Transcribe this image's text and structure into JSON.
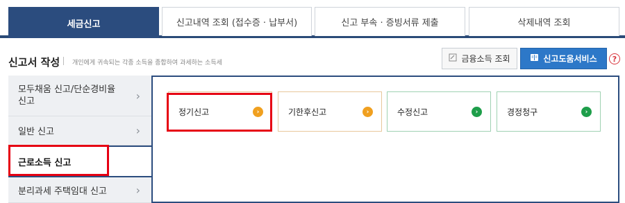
{
  "tabs": [
    {
      "label": "세금신고",
      "active": true
    },
    {
      "label": "신고내역 조회 (접수증 · 납부서)",
      "active": false
    },
    {
      "label": "신고 부속 · 증빙서류 제출",
      "active": false
    },
    {
      "label": "삭제내역 조회",
      "active": false
    }
  ],
  "header": {
    "title": "신고서 작성",
    "subtitle": "개인에게 귀속되는 각종 소득을 종합하여 과세하는 소득세",
    "fin_button": "금융소득 조회",
    "help_button": "신고도움서비스",
    "question_mark": "?"
  },
  "sidebar": {
    "items": [
      {
        "label": "모두채움 신고/단순경비율 신고",
        "active": false
      },
      {
        "label": "일반 신고",
        "active": false
      },
      {
        "label": "근로소득 신고",
        "active": true
      },
      {
        "label": "분리과세 주택임대 신고",
        "active": false
      }
    ],
    "chevron": "›"
  },
  "cards": [
    {
      "label": "정기신고",
      "arrow": "›",
      "color": "#f0a020"
    },
    {
      "label": "기한후신고",
      "arrow": "›",
      "color": "#f0a020"
    },
    {
      "label": "수정신고",
      "arrow": "›",
      "color": "#1e9e4a"
    },
    {
      "label": "경정청구",
      "arrow": "›",
      "color": "#1e9e4a"
    }
  ],
  "icons": {
    "fin_icon": "edit-icon",
    "help_icon": "book-icon",
    "question_icon": "help-icon"
  },
  "colors": {
    "primary": "#2b4c7e",
    "accent_blue": "#2d78c8",
    "highlight_red": "#e60012",
    "orange": "#f0a020",
    "green": "#1e9e4a"
  }
}
